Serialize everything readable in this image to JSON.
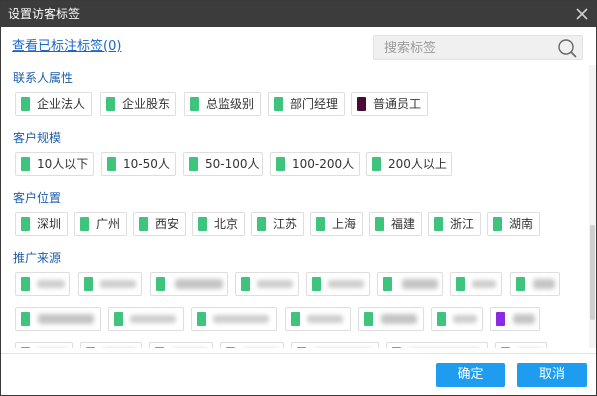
{
  "dialog": {
    "title": "设置访客标签",
    "close_icon": "close-icon"
  },
  "header": {
    "view_tagged_link": "查看已标注标签(0)",
    "search_placeholder": "搜索标签",
    "search_icon": "search-icon"
  },
  "sections": [
    {
      "title": "联系人属性",
      "tags": [
        {
          "label": "企业法人",
          "color": "#3ec47d"
        },
        {
          "label": "企业股东",
          "color": "#3ec47d"
        },
        {
          "label": "总监级别",
          "color": "#3ec47d"
        },
        {
          "label": "部门经理",
          "color": "#3ec47d"
        },
        {
          "label": "普通员工",
          "color": "#4a0a36"
        }
      ]
    },
    {
      "title": "客户规模",
      "tags": [
        {
          "label": "10人以下",
          "color": "#3ec47d"
        },
        {
          "label": "10-50人",
          "color": "#3ec47d"
        },
        {
          "label": "50-100人",
          "color": "#3ec47d"
        },
        {
          "label": "100-200人",
          "color": "#3ec47d"
        },
        {
          "label": "200人以上",
          "color": "#3ec47d"
        }
      ]
    },
    {
      "title": "客户位置",
      "tags": [
        {
          "label": "深圳",
          "color": "#3ec47d"
        },
        {
          "label": "广州",
          "color": "#3ec47d"
        },
        {
          "label": "西安",
          "color": "#3ec47d"
        },
        {
          "label": "北京",
          "color": "#3ec47d"
        },
        {
          "label": "江苏",
          "color": "#3ec47d"
        },
        {
          "label": "上海",
          "color": "#3ec47d"
        },
        {
          "label": "福建",
          "color": "#3ec47d"
        },
        {
          "label": "浙江",
          "color": "#3ec47d"
        },
        {
          "label": "湖南",
          "color": "#3ec47d"
        }
      ]
    },
    {
      "title": "推广来源",
      "tags": []
    }
  ],
  "footer": {
    "confirm_label": "确定",
    "cancel_label": "取消"
  },
  "colors": {
    "accent_blue": "#1e9cf0",
    "link_blue": "#1a66c8",
    "section_blue": "#1d5ea8",
    "titlebar": "#3c3c3c",
    "tag_green": "#3ec47d",
    "tag_purple": "#8a2be2"
  }
}
